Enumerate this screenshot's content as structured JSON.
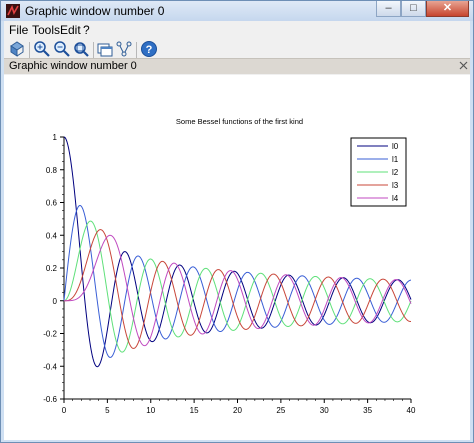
{
  "window": {
    "title": "Graphic window number 0",
    "buttons": {
      "minimize": "–",
      "maximize": "□",
      "close": "✕"
    }
  },
  "menu": {
    "items": [
      "File",
      "Tools",
      "Edit",
      "?"
    ]
  },
  "toolbar": {
    "buttons": [
      "rotate-icon",
      "zoom-in-icon",
      "zoom-out-icon",
      "pan-icon",
      "new-window-icon",
      "datatip-icon",
      "help-icon"
    ]
  },
  "infobar": {
    "text": "Graphic window number 0"
  },
  "chart_data": {
    "type": "line",
    "title": "Some Bessel functions of the first kind",
    "xlabel": "",
    "ylabel": "",
    "xlim": [
      0,
      40
    ],
    "ylim": [
      -0.6,
      1
    ],
    "xticks": [
      "0",
      "5",
      "10",
      "15",
      "20",
      "25",
      "30",
      "35",
      "40"
    ],
    "yticks": [
      "-0.6",
      "-0.4",
      "-0.2",
      "0",
      "0.2",
      "0.4",
      "0.6",
      "0.8",
      "1"
    ],
    "grid": false,
    "legend_position": "top-right",
    "series": [
      {
        "name": "l0",
        "order": 0,
        "color": "#00007f"
      },
      {
        "name": "l1",
        "order": 1,
        "color": "#3a5fd6"
      },
      {
        "name": "l2",
        "order": 2,
        "color": "#5fe07a"
      },
      {
        "name": "l3",
        "order": 3,
        "color": "#c8473a"
      },
      {
        "name": "l4",
        "order": 4,
        "color": "#c04ac0"
      }
    ]
  }
}
